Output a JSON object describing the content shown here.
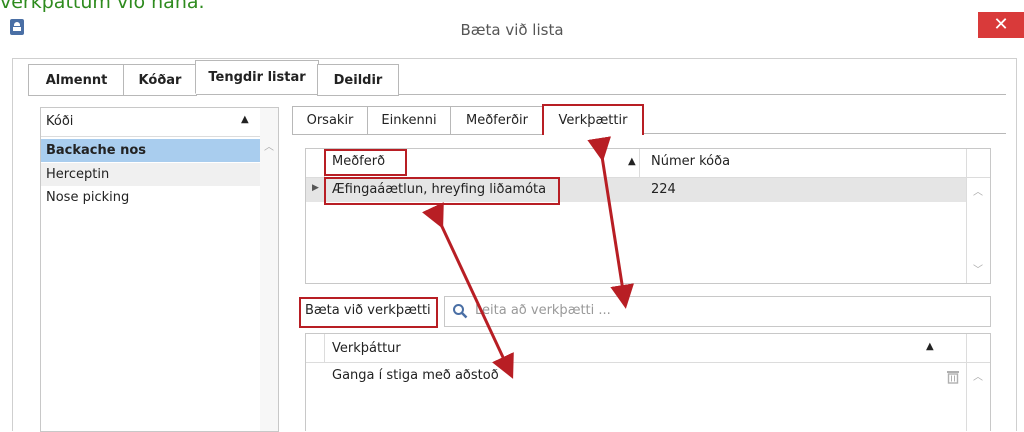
{
  "caption": "verkþáttum við hana.",
  "window": {
    "title": "Bæta við lista",
    "close_glyph": "✕"
  },
  "main_tabs": [
    "Almennt",
    "Kóðar",
    "Tengdir listar",
    "Deildir"
  ],
  "left_list": {
    "header": "Kóði",
    "sort_glyph": "▲",
    "items": [
      "Backache nos",
      "Herceptin",
      "Nose picking"
    ],
    "selected": "Backache nos"
  },
  "sub_tabs": [
    "Orsakir",
    "Einkenni",
    "Meðferðir",
    "Verkþættir"
  ],
  "treatments_grid": {
    "col1": "Meðferð",
    "col2": "Númer kóða",
    "sort_glyph": "▲",
    "rows": [
      {
        "name": "Æfingaáætlun, hreyfing liðamóta",
        "code": "224"
      }
    ]
  },
  "add_task": {
    "label": "Bæta við verkþætti",
    "placeholder": "Leita að verkþætti ..."
  },
  "tasks_grid": {
    "header": "Verkþáttur",
    "sort_glyph": "▲",
    "rows": [
      "Ganga í stiga með aðstoð"
    ]
  },
  "colors": {
    "annotation_red": "#b81e24",
    "selection_blue": "#a9cdee",
    "close_red": "#d93a3a",
    "caption_green": "#2e8b1e"
  }
}
